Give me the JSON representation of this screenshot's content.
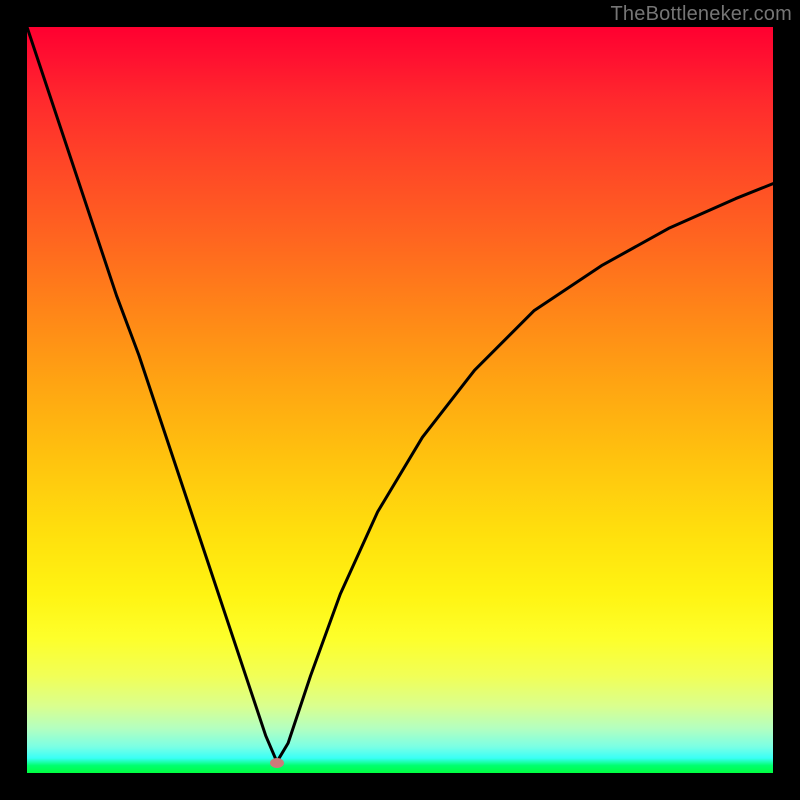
{
  "watermark": "TheBottleneker.com",
  "chart_data": {
    "type": "line",
    "title": "",
    "xlabel": "",
    "ylabel": "",
    "xlim": [
      0,
      100
    ],
    "ylim": [
      0,
      100
    ],
    "background": "rainbow-vertical-gradient",
    "note": "No axis ticks present; x/y values are estimated from pixel positions as percentage of plot area. y=0 is bottom (green), y=100 is top (red). Curve resembles a bottleneck V-shape with minimum near x≈33.",
    "series": [
      {
        "name": "bottleneck-curve",
        "x": [
          0,
          3,
          6,
          9,
          12,
          15,
          18,
          21,
          24,
          27,
          30,
          32,
          33.5,
          35,
          38,
          42,
          47,
          53,
          60,
          68,
          77,
          86,
          95,
          100
        ],
        "y": [
          100,
          91,
          82,
          73,
          64,
          56,
          47,
          38,
          29,
          20,
          11,
          5,
          1.5,
          4,
          13,
          24,
          35,
          45,
          54,
          62,
          68,
          73,
          77,
          79
        ]
      }
    ],
    "marker": {
      "x_pct": 33.5,
      "y_pct": 1.4,
      "color": "#cc7a7a"
    }
  },
  "colors": {
    "frame": "#000000",
    "curve": "#000000",
    "watermark": "#757575"
  }
}
